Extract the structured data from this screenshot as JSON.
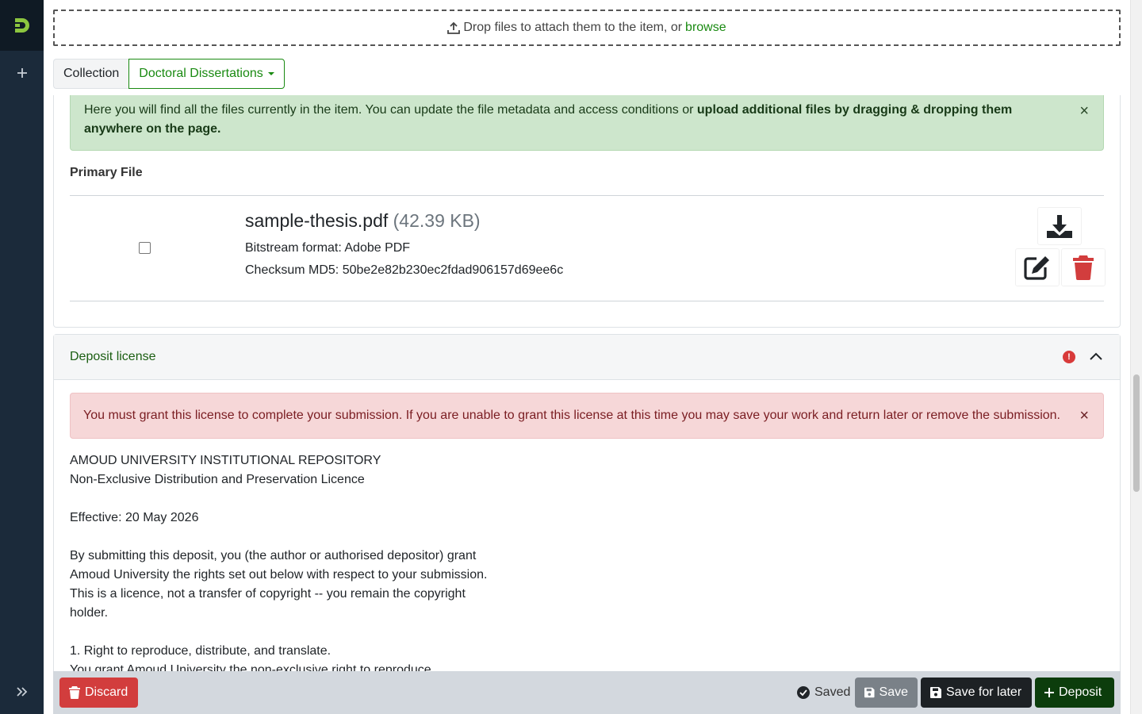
{
  "upload": {
    "drop_text": "Drop files to attach them to the item, or",
    "browse_label": "browse"
  },
  "collection": {
    "label": "Collection",
    "selected": "Doctoral Dissertations"
  },
  "files_alert": {
    "text_plain": "Here you will find all the files currently in the item. You can update the file metadata and access conditions or ",
    "text_bold": "upload additional files by dragging & dropping them anywhere on the page.",
    "close": "×"
  },
  "primary_file": {
    "heading": "Primary File",
    "name": "sample-thesis.pdf",
    "size": "(42.39 KB)",
    "format": "Bitstream format: Adobe PDF",
    "checksum": "Checksum MD5: 50be2e82b230ec2fdad906157d69ee6c"
  },
  "license": {
    "title": "Deposit license",
    "warning_badge": "!",
    "alert": "You must grant this license to complete your submission. If you are unable to grant this license at this time you may save your work and return later or remove the submission.",
    "alert_close": "×",
    "lines": [
      "AMOUD UNIVERSITY INSTITUTIONAL REPOSITORY",
      "Non-Exclusive Distribution and Preservation Licence",
      "",
      "Effective: 20 May 2026",
      "",
      "By submitting this deposit, you (the author or authorised depositor) grant",
      "Amoud University the rights set out below with respect to your submission.",
      "This is a licence, not a transfer of copyright -- you remain the copyright",
      "holder.",
      "",
      "1. Right to reproduce, distribute, and translate.",
      "You grant Amoud University the non-exclusive right to reproduce,"
    ]
  },
  "footer": {
    "discard": "Discard",
    "status": "Saved",
    "save": "Save",
    "save_later": "Save for later",
    "deposit": "Deposit"
  },
  "colors": {
    "sidebar": "#1b2a3a",
    "accent_green": "#1a8a12",
    "danger": "#d23d3d",
    "deposit": "#0c3d0c"
  }
}
